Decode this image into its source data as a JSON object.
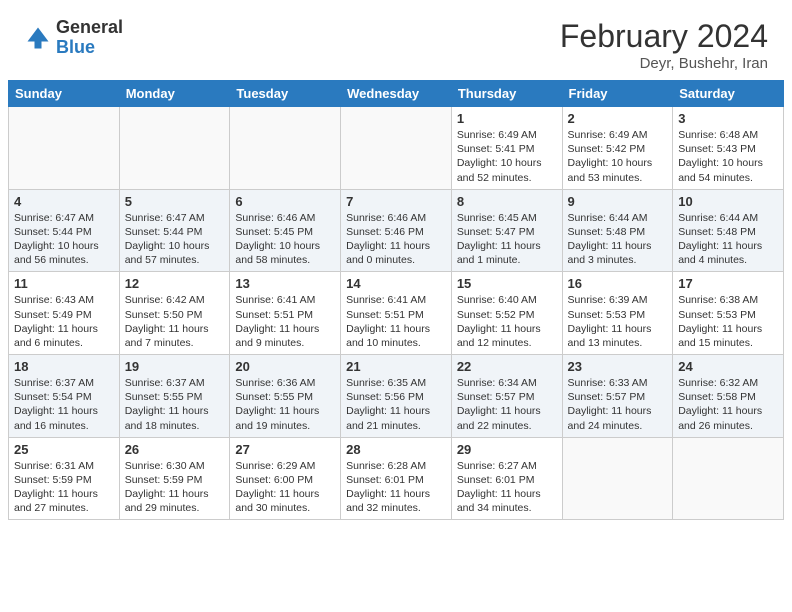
{
  "logo": {
    "general": "General",
    "blue": "Blue"
  },
  "title": "February 2024",
  "location": "Deyr, Bushehr, Iran",
  "weekdays": [
    "Sunday",
    "Monday",
    "Tuesday",
    "Wednesday",
    "Thursday",
    "Friday",
    "Saturday"
  ],
  "weeks": [
    [
      {
        "day": "",
        "info": ""
      },
      {
        "day": "",
        "info": ""
      },
      {
        "day": "",
        "info": ""
      },
      {
        "day": "",
        "info": ""
      },
      {
        "day": "1",
        "info": "Sunrise: 6:49 AM\nSunset: 5:41 PM\nDaylight: 10 hours and 52 minutes."
      },
      {
        "day": "2",
        "info": "Sunrise: 6:49 AM\nSunset: 5:42 PM\nDaylight: 10 hours and 53 minutes."
      },
      {
        "day": "3",
        "info": "Sunrise: 6:48 AM\nSunset: 5:43 PM\nDaylight: 10 hours and 54 minutes."
      }
    ],
    [
      {
        "day": "4",
        "info": "Sunrise: 6:47 AM\nSunset: 5:44 PM\nDaylight: 10 hours and 56 minutes."
      },
      {
        "day": "5",
        "info": "Sunrise: 6:47 AM\nSunset: 5:44 PM\nDaylight: 10 hours and 57 minutes."
      },
      {
        "day": "6",
        "info": "Sunrise: 6:46 AM\nSunset: 5:45 PM\nDaylight: 10 hours and 58 minutes."
      },
      {
        "day": "7",
        "info": "Sunrise: 6:46 AM\nSunset: 5:46 PM\nDaylight: 11 hours and 0 minutes."
      },
      {
        "day": "8",
        "info": "Sunrise: 6:45 AM\nSunset: 5:47 PM\nDaylight: 11 hours and 1 minute."
      },
      {
        "day": "9",
        "info": "Sunrise: 6:44 AM\nSunset: 5:48 PM\nDaylight: 11 hours and 3 minutes."
      },
      {
        "day": "10",
        "info": "Sunrise: 6:44 AM\nSunset: 5:48 PM\nDaylight: 11 hours and 4 minutes."
      }
    ],
    [
      {
        "day": "11",
        "info": "Sunrise: 6:43 AM\nSunset: 5:49 PM\nDaylight: 11 hours and 6 minutes."
      },
      {
        "day": "12",
        "info": "Sunrise: 6:42 AM\nSunset: 5:50 PM\nDaylight: 11 hours and 7 minutes."
      },
      {
        "day": "13",
        "info": "Sunrise: 6:41 AM\nSunset: 5:51 PM\nDaylight: 11 hours and 9 minutes."
      },
      {
        "day": "14",
        "info": "Sunrise: 6:41 AM\nSunset: 5:51 PM\nDaylight: 11 hours and 10 minutes."
      },
      {
        "day": "15",
        "info": "Sunrise: 6:40 AM\nSunset: 5:52 PM\nDaylight: 11 hours and 12 minutes."
      },
      {
        "day": "16",
        "info": "Sunrise: 6:39 AM\nSunset: 5:53 PM\nDaylight: 11 hours and 13 minutes."
      },
      {
        "day": "17",
        "info": "Sunrise: 6:38 AM\nSunset: 5:53 PM\nDaylight: 11 hours and 15 minutes."
      }
    ],
    [
      {
        "day": "18",
        "info": "Sunrise: 6:37 AM\nSunset: 5:54 PM\nDaylight: 11 hours and 16 minutes."
      },
      {
        "day": "19",
        "info": "Sunrise: 6:37 AM\nSunset: 5:55 PM\nDaylight: 11 hours and 18 minutes."
      },
      {
        "day": "20",
        "info": "Sunrise: 6:36 AM\nSunset: 5:55 PM\nDaylight: 11 hours and 19 minutes."
      },
      {
        "day": "21",
        "info": "Sunrise: 6:35 AM\nSunset: 5:56 PM\nDaylight: 11 hours and 21 minutes."
      },
      {
        "day": "22",
        "info": "Sunrise: 6:34 AM\nSunset: 5:57 PM\nDaylight: 11 hours and 22 minutes."
      },
      {
        "day": "23",
        "info": "Sunrise: 6:33 AM\nSunset: 5:57 PM\nDaylight: 11 hours and 24 minutes."
      },
      {
        "day": "24",
        "info": "Sunrise: 6:32 AM\nSunset: 5:58 PM\nDaylight: 11 hours and 26 minutes."
      }
    ],
    [
      {
        "day": "25",
        "info": "Sunrise: 6:31 AM\nSunset: 5:59 PM\nDaylight: 11 hours and 27 minutes."
      },
      {
        "day": "26",
        "info": "Sunrise: 6:30 AM\nSunset: 5:59 PM\nDaylight: 11 hours and 29 minutes."
      },
      {
        "day": "27",
        "info": "Sunrise: 6:29 AM\nSunset: 6:00 PM\nDaylight: 11 hours and 30 minutes."
      },
      {
        "day": "28",
        "info": "Sunrise: 6:28 AM\nSunset: 6:01 PM\nDaylight: 11 hours and 32 minutes."
      },
      {
        "day": "29",
        "info": "Sunrise: 6:27 AM\nSunset: 6:01 PM\nDaylight: 11 hours and 34 minutes."
      },
      {
        "day": "",
        "info": ""
      },
      {
        "day": "",
        "info": ""
      }
    ]
  ]
}
